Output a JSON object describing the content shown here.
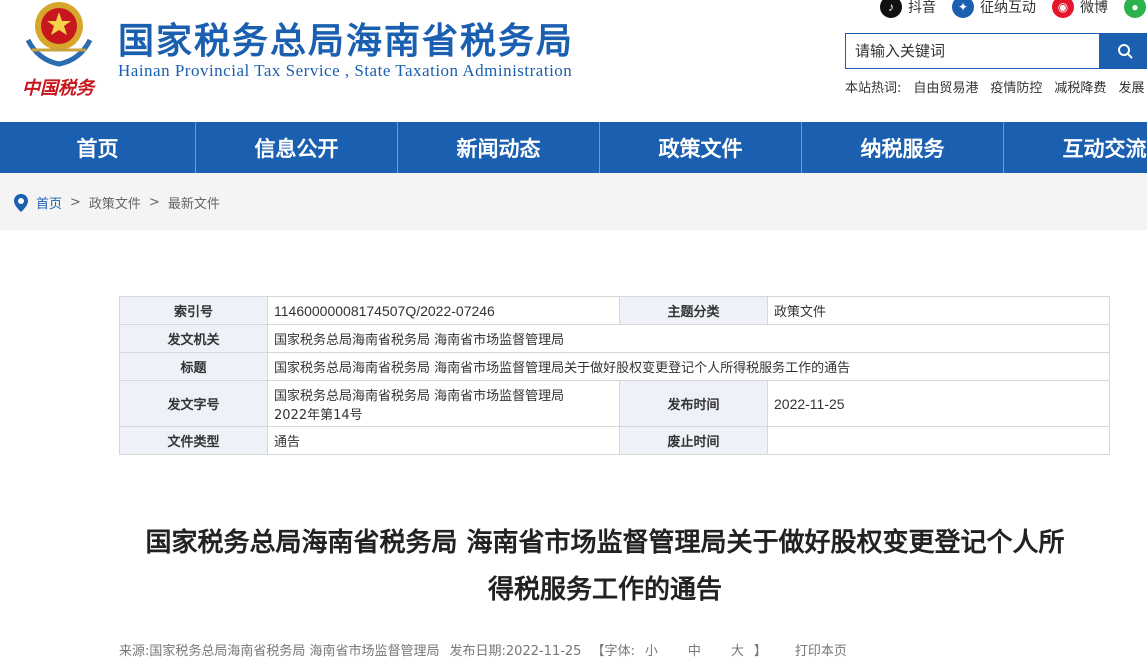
{
  "header": {
    "emblem_caption": "中国税务",
    "title": "国家税务总局海南省税务局",
    "subtitle": "Hainan Provincial Tax Service , State Taxation Administration",
    "social": [
      {
        "label": "抖音",
        "icon": "douyin-icon",
        "color": "#111111"
      },
      {
        "label": "征纳互动",
        "icon": "interaction-icon",
        "color": "#1b5fb0"
      },
      {
        "label": "微博",
        "icon": "weibo-icon",
        "color": "#e6162d"
      }
    ],
    "search": {
      "placeholder": "请输入关键词"
    },
    "hot_words_label": "本站热词:",
    "hot_words": [
      "自由贸易港",
      "疫情防控",
      "减税降费",
      "发展"
    ]
  },
  "nav": {
    "items": [
      "首页",
      "信息公开",
      "新闻动态",
      "政策文件",
      "纳税服务",
      "互动交流"
    ]
  },
  "breadcrumb": {
    "items": [
      "首页",
      "政策文件",
      "最新文件"
    ],
    "separator": ">"
  },
  "meta": {
    "index_label": "索引号",
    "index_value": "11460000008174507Q/2022-07246",
    "topic_label": "主题分类",
    "topic_value": "政策文件",
    "issuer_label": "发文机关",
    "issuer_value": "国家税务总局海南省税务局 海南省市场监督管理局",
    "title_label": "标题",
    "title_value": "国家税务总局海南省税务局 海南省市场监督管理局关于做好股权变更登记个人所得税服务工作的通告",
    "docno_label": "发文字号",
    "docno_value_line1": "国家税务总局海南省税务局 海南省市场监督管理局",
    "docno_value_line2": "2022年第14号",
    "date_label": "发布时间",
    "date_value": "2022-11-25",
    "type_label": "文件类型",
    "type_value": "通告",
    "abolish_label": "废止时间",
    "abolish_value": ""
  },
  "article": {
    "title_line1": "国家税务总局海南省税务局 海南省市场监督管理局关于做好股权变更登记个人所",
    "title_line2": "得税服务工作的通告",
    "source": "来源:国家税务总局海南省税务局 海南省市场监督管理局",
    "publish": "发布日期:2022-11-25",
    "font_label": "【字体:",
    "font_small": "小",
    "font_medium": "中",
    "font_large": "大",
    "font_close": "】",
    "print": "打印本页"
  },
  "colors": {
    "brand": "#1b5fb0",
    "emblem_red": "#c8161d"
  }
}
